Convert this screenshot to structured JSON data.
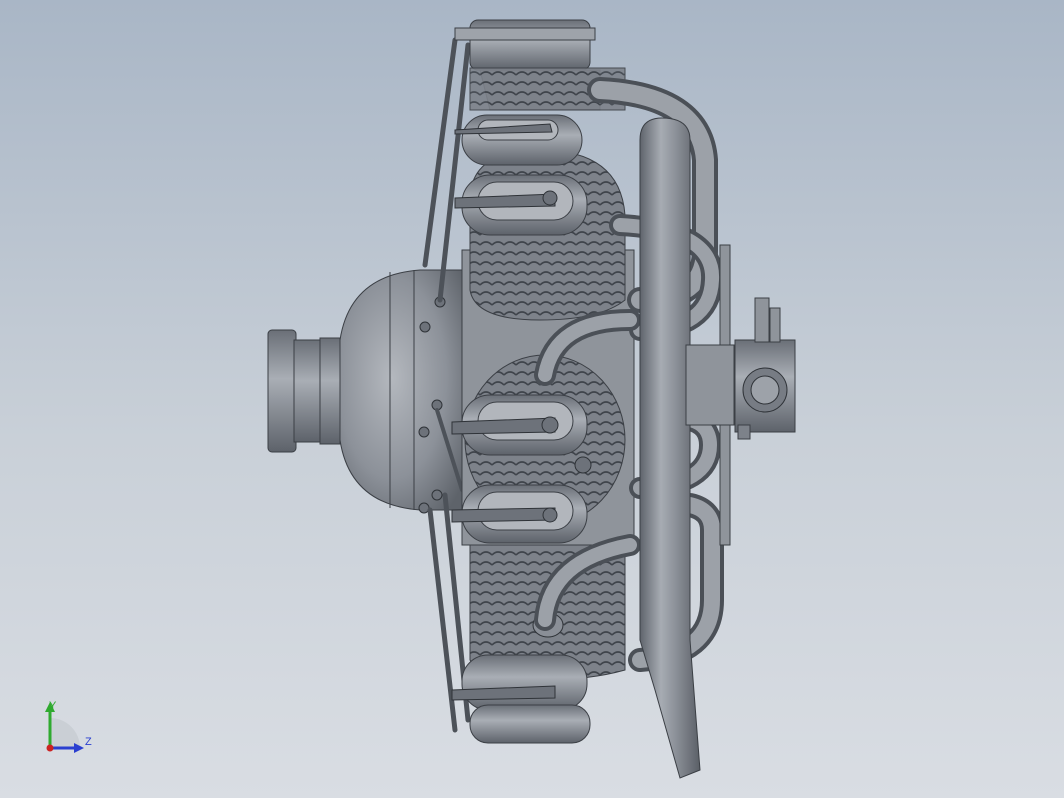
{
  "viewport": {
    "background_top": "#a9b6c6",
    "background_bottom": "#d9dde3",
    "model_color": "#8a8f97"
  },
  "model": {
    "name": "radial-engine-assembly",
    "view": "side"
  },
  "triad": {
    "y_label": "Y",
    "z_label": "Z",
    "y_color": "#2faa2f",
    "z_color": "#2a3fd0",
    "origin_color": "#cc2222"
  }
}
